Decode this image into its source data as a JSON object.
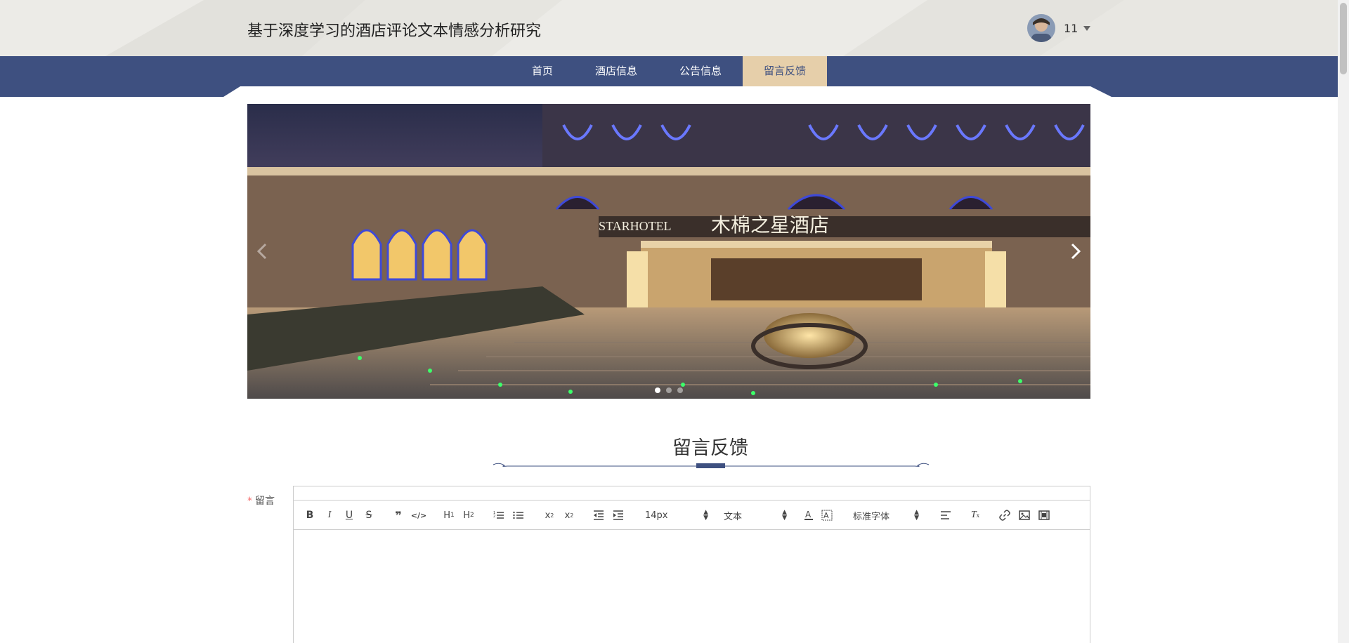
{
  "header": {
    "site_title": "基于深度学习的酒店评论文本情感分析研究",
    "username": "11"
  },
  "nav": {
    "items": [
      {
        "label": "首页",
        "active": false
      },
      {
        "label": "酒店信息",
        "active": false
      },
      {
        "label": "公告信息",
        "active": false
      },
      {
        "label": "留言反馈",
        "active": true
      }
    ]
  },
  "carousel": {
    "slide_count": 3,
    "active_index": 0
  },
  "page": {
    "section_title": "留言反馈"
  },
  "form": {
    "field_label": "留言",
    "required_mark": "*",
    "editor": {
      "font_size": "14px",
      "block_type": "文本",
      "font_family": "标准字体"
    }
  },
  "colors": {
    "nav_bg": "#3e5080",
    "nav_active_bg": "#e6cfaa",
    "header_bg": "#ecebe7",
    "required": "#f56c6c"
  }
}
